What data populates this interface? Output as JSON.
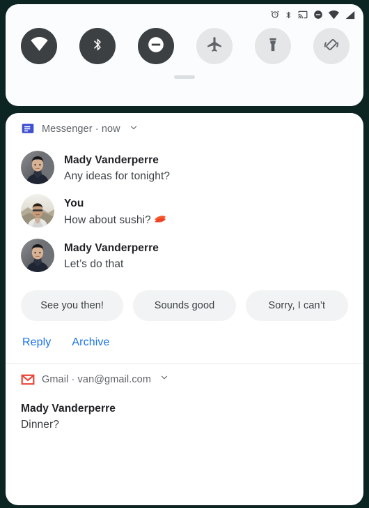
{
  "theme": {
    "background": "#0c2522",
    "panel_bg": "#ffffff",
    "qs_panel_bg": "#fafcfd",
    "tile_on": "#3c4043",
    "tile_off": "#e4e6e8",
    "accent_link": "#1a73e8",
    "chip_bg": "#f1f3f4",
    "messenger_blue": "#3f51cf",
    "gmail_red": "#ea4335"
  },
  "statusbar": {
    "icons": [
      {
        "name": "alarm-icon",
        "label": "alarm"
      },
      {
        "name": "bluetooth-icon",
        "label": "bluetooth"
      },
      {
        "name": "cast-icon",
        "label": "cast"
      },
      {
        "name": "do-not-disturb-icon",
        "label": "do not disturb"
      },
      {
        "name": "wifi-icon",
        "label": "wifi"
      },
      {
        "name": "cell-signal-icon",
        "label": "signal"
      }
    ]
  },
  "quick_settings": {
    "tiles": [
      {
        "name": "wifi",
        "label": "Wi-Fi",
        "state": "on"
      },
      {
        "name": "bluetooth",
        "label": "Bluetooth",
        "state": "on"
      },
      {
        "name": "dnd",
        "label": "Do Not Disturb",
        "state": "on"
      },
      {
        "name": "airplane",
        "label": "Airplane mode",
        "state": "off"
      },
      {
        "name": "flashlight",
        "label": "Flashlight",
        "state": "off"
      },
      {
        "name": "auto-rotate",
        "label": "Auto-rotate",
        "state": "off"
      }
    ]
  },
  "notifications": [
    {
      "app": "Messenger",
      "time": "now",
      "header": "Messenger · now",
      "messages": [
        {
          "sender": "Mady Vanderperre",
          "text": "Any ideas for tonight?",
          "avatar": "mady"
        },
        {
          "sender": "You",
          "text": "How about sushi?",
          "emoji": "sushi",
          "avatar": "you"
        },
        {
          "sender": "Mady Vanderperre",
          "text": "Let’s do that",
          "avatar": "mady"
        }
      ],
      "smart_replies": [
        "See you then!",
        "Sounds good",
        "Sorry, I can’t"
      ],
      "actions": [
        "Reply",
        "Archive"
      ]
    },
    {
      "app": "Gmail",
      "account": "van@gmail.com",
      "header": "Gmail · van@gmail.com",
      "title": "Mady Vanderperre",
      "subject": "Dinner?"
    }
  ]
}
